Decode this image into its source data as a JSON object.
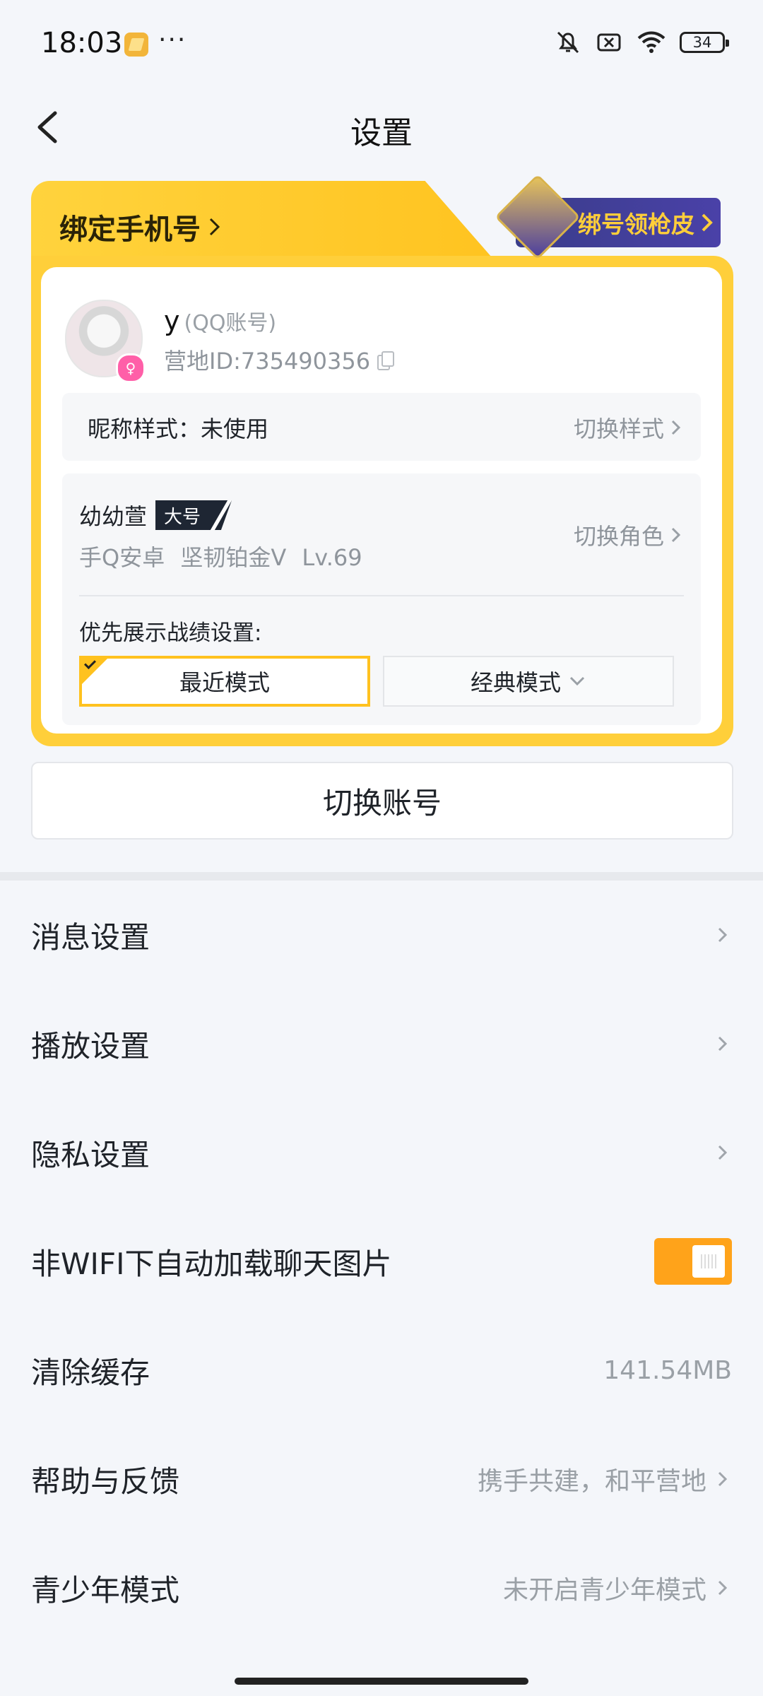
{
  "status_bar": {
    "time": "18:03",
    "dots": "···",
    "battery": "34"
  },
  "header": {
    "title": "设置"
  },
  "account": {
    "bind_phone_label": "绑定手机号",
    "promo_label": "绑号领枪皮",
    "user_name": "y",
    "account_type": "(QQ账号)",
    "camp_id": "营地ID:735490356",
    "nickname_style": "昵称样式：未使用",
    "switch_style": "切换样式",
    "role_name": "幼幼萱",
    "role_badge": "大号",
    "role_info": "手Q安卓  坚韧铂金V  Lv.69",
    "switch_role": "切换角色",
    "record_pref_label": "优先展示战绩设置:",
    "mode_recent": "最近模式",
    "mode_classic": "经典模式"
  },
  "switch_account_label": "切换账号",
  "settings": {
    "message": "消息设置",
    "playback": "播放设置",
    "privacy": "隐私设置",
    "wifi_images": "非WIFI下自动加载聊天图片",
    "wifi_images_enabled": true,
    "clear_cache": "清除缓存",
    "cache_size": "141.54MB",
    "help": "帮助与反馈",
    "help_subtitle": "携手共建，和平营地",
    "teen": "青少年模式",
    "teen_subtitle": "未开启青少年模式"
  },
  "colors": {
    "accent": "#ffc21f",
    "toggle": "#ffa31a",
    "promo_bg": "#3a3d8a"
  }
}
